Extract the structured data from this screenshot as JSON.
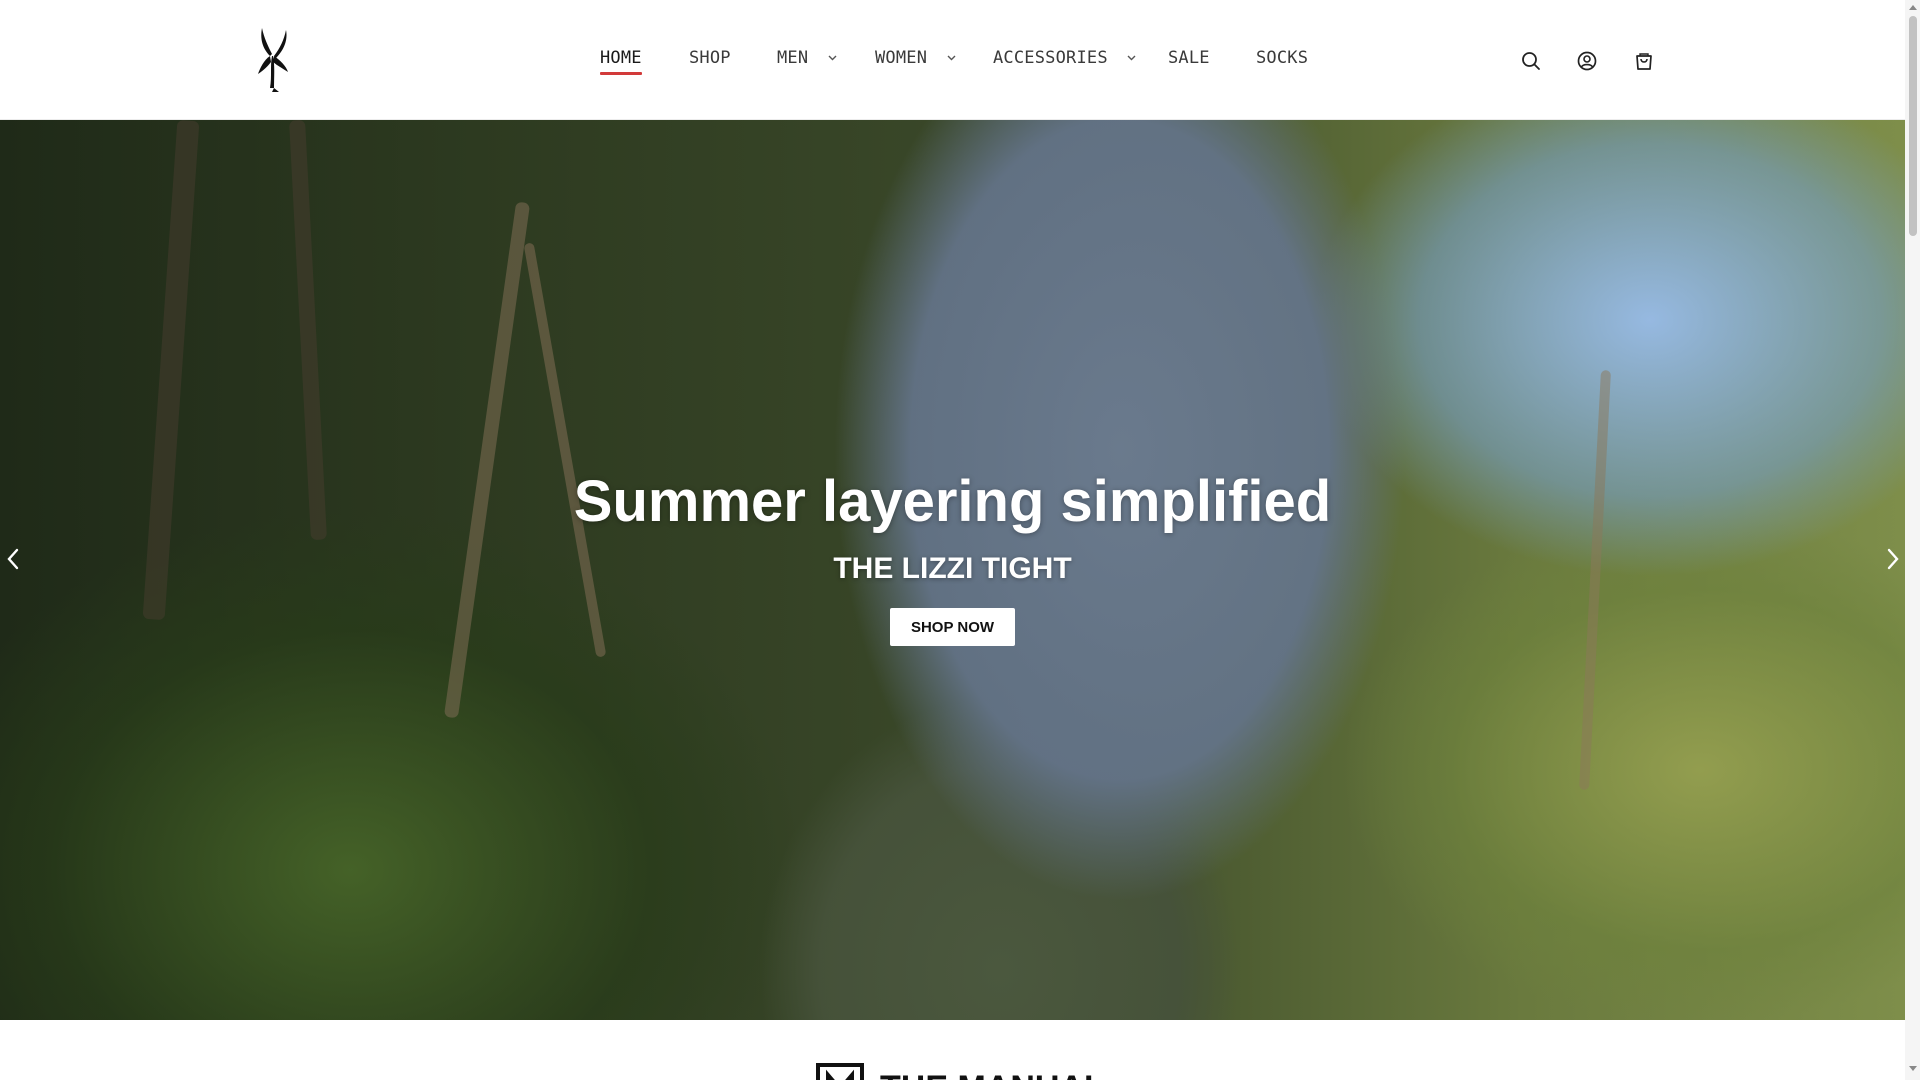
{
  "nav": {
    "items": [
      {
        "label": "HOME",
        "active": true
      },
      {
        "label": "SHOP"
      },
      {
        "label": "MEN",
        "dropdown": true
      },
      {
        "label": "WOMEN",
        "dropdown": true
      },
      {
        "label": "ACCESSORIES",
        "dropdown": true
      },
      {
        "label": "SALE"
      },
      {
        "label": "SOCKS"
      }
    ],
    "active_underline_color": "#d23a3a"
  },
  "header_icons": [
    "search-icon",
    "account-icon",
    "cart-icon"
  ],
  "hero": {
    "title": "Summer layering simplified",
    "subtitle": "THE LIZZI TIGHT",
    "button_label": "SHOP NOW"
  },
  "next_section": {
    "logo_text": "THE MANUAL"
  }
}
